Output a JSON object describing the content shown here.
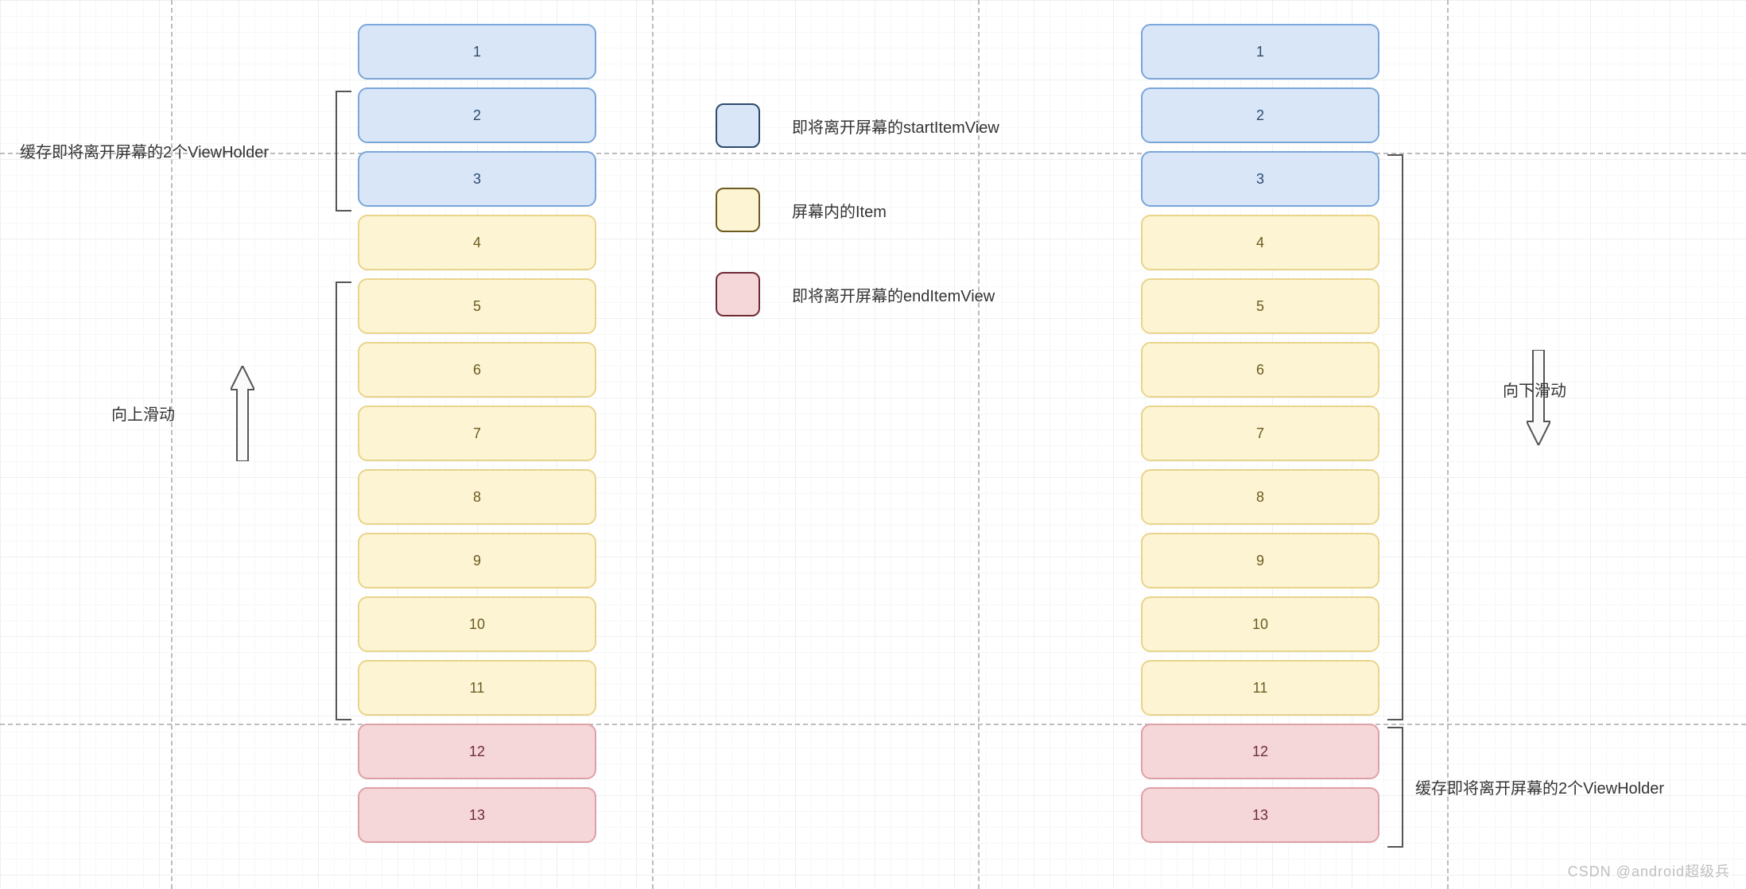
{
  "items_left": [
    "1",
    "2",
    "3",
    "4",
    "5",
    "6",
    "7",
    "8",
    "9",
    "10",
    "11",
    "12",
    "13"
  ],
  "items_right": [
    "1",
    "2",
    "3",
    "4",
    "5",
    "6",
    "7",
    "8",
    "9",
    "10",
    "11",
    "12",
    "13"
  ],
  "types_left": [
    "blue",
    "blue",
    "blue",
    "yellow",
    "yellow",
    "yellow",
    "yellow",
    "yellow",
    "yellow",
    "yellow",
    "yellow",
    "pink",
    "pink"
  ],
  "types_right": [
    "blue",
    "blue",
    "blue",
    "yellow",
    "yellow",
    "yellow",
    "yellow",
    "yellow",
    "yellow",
    "yellow",
    "yellow",
    "pink",
    "pink"
  ],
  "labels": {
    "cache_left": "缓存即将离开屏幕的2个ViewHolder",
    "cache_right": "缓存即将离开屏幕的2个ViewHolder",
    "scroll_up": "向上滑动",
    "scroll_down": "向下滑动"
  },
  "legend": {
    "start": "即将离开屏幕的startItemView",
    "mid": "屏幕内的Item",
    "end": "即将离开屏幕的endItemView"
  },
  "watermark": "CSDN @android超级兵"
}
